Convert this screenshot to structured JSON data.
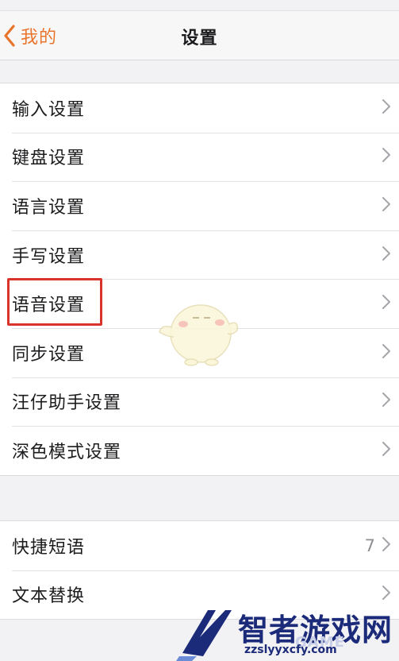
{
  "navbar": {
    "back_label": "我的",
    "title": "设置"
  },
  "group1": {
    "items": [
      {
        "label": "输入设置"
      },
      {
        "label": "键盘设置"
      },
      {
        "label": "语言设置"
      },
      {
        "label": "手写设置"
      },
      {
        "label": "语音设置"
      },
      {
        "label": "同步设置"
      },
      {
        "label": "汪仔助手设置"
      },
      {
        "label": "深色模式设置"
      }
    ]
  },
  "group2": {
    "items": [
      {
        "label": "快捷短语",
        "value": "7"
      },
      {
        "label": "文本替换"
      }
    ]
  },
  "watermark": {
    "brand_cn": "智者游戏网",
    "brand_en": "GAME",
    "url": "zzslyyxcfy.com"
  },
  "icons": {
    "back": "chevron-left-icon",
    "row_arrow": "chevron-right-icon",
    "mascot": "mascot-icon",
    "logo": "logo-icon"
  },
  "colors": {
    "accent": "#e9742b",
    "highlight": "#d9342b",
    "background": "#f2f2f4",
    "watermark": "#1c2a7a"
  }
}
